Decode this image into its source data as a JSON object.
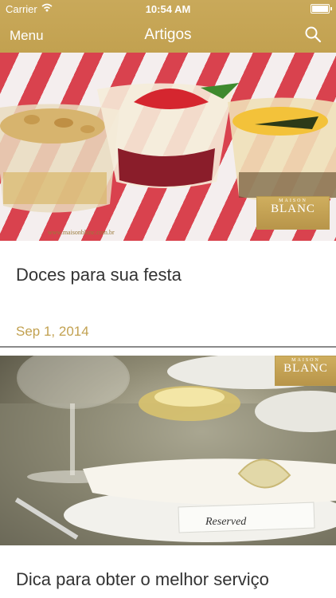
{
  "status_bar": {
    "carrier": "Carrier",
    "time": "10:54 AM"
  },
  "nav": {
    "menu_label": "Menu",
    "title": "Artigos",
    "search_icon": "search-icon"
  },
  "articles": [
    {
      "title": "Doces para sua festa",
      "date": "Sep 1, 2014",
      "image_logo": {
        "small": "MAISON",
        "big": "BLANC"
      },
      "watermark": "www.maisonblanc.com.br"
    },
    {
      "title": "Dica para obter o melhor serviço",
      "image_logo": {
        "small": "MAISON",
        "big": "BLANC"
      },
      "card_text": "Reserved"
    }
  ],
  "colors": {
    "accent": "#c2a150",
    "title_text": "#333333"
  }
}
